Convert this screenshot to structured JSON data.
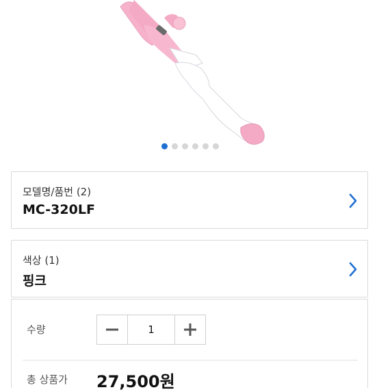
{
  "image_dots": {
    "count": 6,
    "active_index": 0
  },
  "model_option": {
    "label": "모델명/품번 (2)",
    "value": "MC-320LF"
  },
  "color_option": {
    "label": "색상 (1)",
    "value": "핑크"
  },
  "quantity": {
    "label": "수량",
    "value": "1",
    "minus_icon": "minus-icon",
    "plus_icon": "plus-icon"
  },
  "total": {
    "label": "총 상품가",
    "value": "27,500원"
  },
  "colors": {
    "accent": "#1f6fd1",
    "product_pink": "#f4a9c4"
  }
}
